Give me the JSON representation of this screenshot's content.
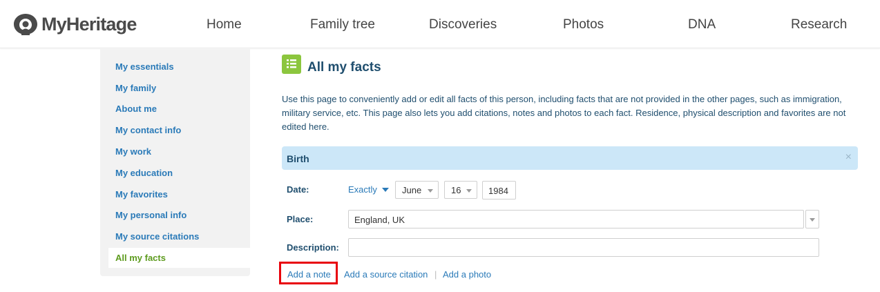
{
  "header": {
    "logo_text": "MyHeritage",
    "nav": [
      "Home",
      "Family tree",
      "Discoveries",
      "Photos",
      "DNA",
      "Research"
    ]
  },
  "sidebar": {
    "items": [
      {
        "label": "My essentials"
      },
      {
        "label": "My family"
      },
      {
        "label": "About me"
      },
      {
        "label": "My contact info"
      },
      {
        "label": "My work"
      },
      {
        "label": "My education"
      },
      {
        "label": "My favorites"
      },
      {
        "label": "My personal info"
      },
      {
        "label": "My source citations"
      },
      {
        "label": "All my facts",
        "active": true
      }
    ]
  },
  "main": {
    "title": "All my facts",
    "intro": "Use this page to conveniently add or edit all facts of this person, including facts that are not provided in the other pages, such as immigration, military service, etc. This page also lets you add citations, notes and photos to each fact. Residence, physical description and favorites are not edited here.",
    "section": {
      "title": "Birth",
      "close": "×",
      "date_label": "Date:",
      "date_qualifier": "Exactly",
      "month": "June",
      "day": "16",
      "year": "1984",
      "place_label": "Place:",
      "place_value": "England, UK",
      "description_label": "Description:",
      "description_value": ""
    },
    "links": {
      "add_note": "Add a note",
      "add_citation": "Add a source citation",
      "add_photo": "Add a photo",
      "separator": "|"
    }
  },
  "colors": {
    "link": "#2a7ab8",
    "active": "#5d9b1e",
    "section_bg": "#cce7f8",
    "highlight": "#e8000b"
  },
  "icons": {
    "logo": "myheritage-logo-icon",
    "title": "list-icon",
    "dropdown": "chevron-down-icon",
    "close": "close-icon"
  }
}
